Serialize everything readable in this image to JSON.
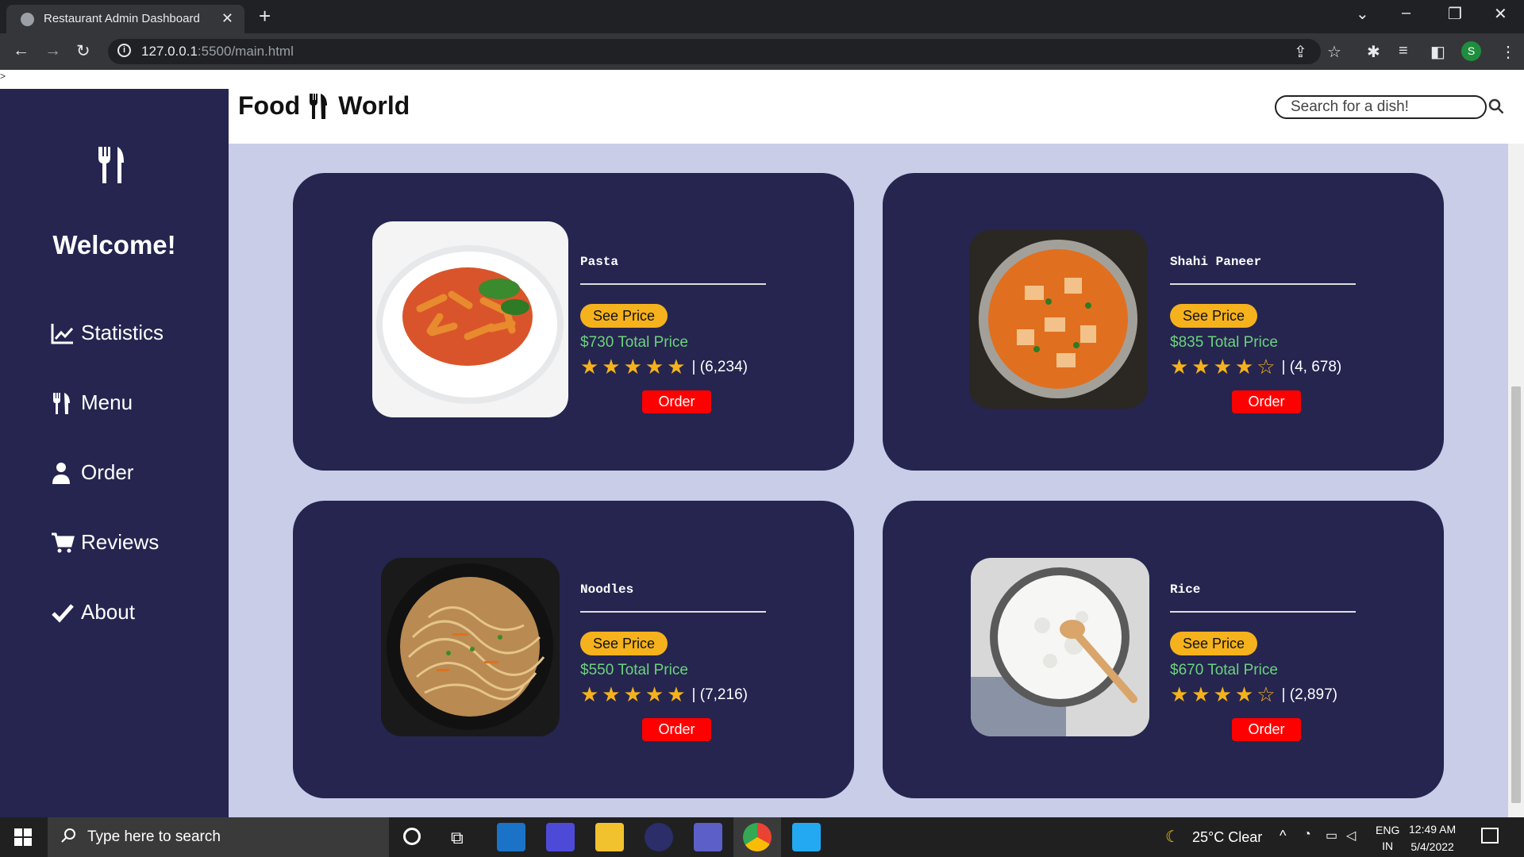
{
  "browser": {
    "tab_title": "Restaurant Admin Dashboard",
    "url_host": "127.0.0.1",
    "url_rest": ":5500/main.html"
  },
  "page": {
    "stray_text": ">",
    "welcome": "Welcome!",
    "nav": [
      {
        "label": "Statistics",
        "icon": "chart-line-icon"
      },
      {
        "label": "Menu",
        "icon": "utensils-icon"
      },
      {
        "label": "Order",
        "icon": "user-icon"
      },
      {
        "label": "Reviews",
        "icon": "cart-icon"
      },
      {
        "label": "About",
        "icon": "check-icon"
      }
    ],
    "brand_left": "Food",
    "brand_right": "World",
    "search_placeholder": "Search for a dish!",
    "dishes": [
      {
        "name": "Pasta",
        "price_button": "See Price",
        "total": "$730 Total Price",
        "rating": 5,
        "reviews": "| (6,234)",
        "order": "Order"
      },
      {
        "name": "Shahi Paneer",
        "price_button": "See Price",
        "total": "$835 Total Price",
        "rating": 4,
        "reviews": "| (4, 678)",
        "order": "Order"
      },
      {
        "name": "Noodles",
        "price_button": "See Price",
        "total": "$550 Total Price",
        "rating": 5,
        "reviews": "| (7,216)",
        "order": "Order"
      },
      {
        "name": "Rice",
        "price_button": "See Price",
        "total": "$670 Total Price",
        "rating": 4,
        "reviews": "| (2,897)",
        "order": "Order"
      }
    ]
  },
  "taskbar": {
    "search_placeholder": "Type here to search",
    "weather": "25°C  Clear",
    "lang_top": "ENG",
    "lang_bottom": "IN",
    "time": "12:49 AM",
    "date": "5/4/2022"
  },
  "colors": {
    "sidebar": "#252550",
    "card": "#252550",
    "content_bg": "#c9cde8",
    "accent_yellow": "#f5b21c",
    "order_red": "#ff0000",
    "price_green": "#6cd37c"
  }
}
